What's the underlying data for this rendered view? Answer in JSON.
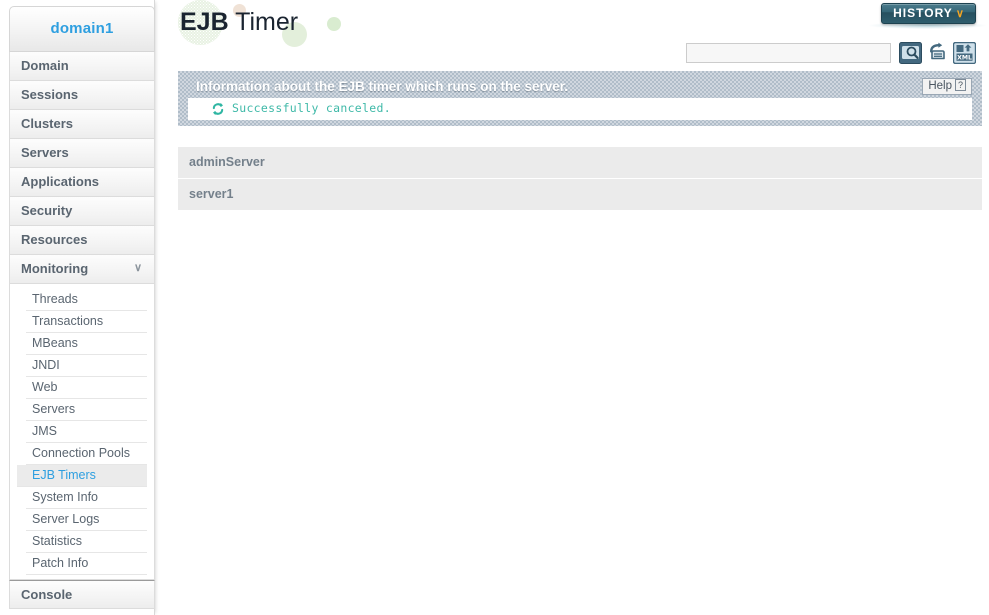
{
  "sidebar": {
    "domain_label": "domain1",
    "items": [
      {
        "label": "Domain",
        "expandable": false
      },
      {
        "label": "Sessions",
        "expandable": false
      },
      {
        "label": "Clusters",
        "expandable": false
      },
      {
        "label": "Servers",
        "expandable": false
      },
      {
        "label": "Applications",
        "expandable": false
      },
      {
        "label": "Security",
        "expandable": false
      },
      {
        "label": "Resources",
        "expandable": false
      },
      {
        "label": "Monitoring",
        "expandable": true,
        "chevron": "∨"
      }
    ],
    "monitoring_submenu": [
      {
        "label": "Threads",
        "selected": false
      },
      {
        "label": "Transactions",
        "selected": false
      },
      {
        "label": "MBeans",
        "selected": false
      },
      {
        "label": "JNDI",
        "selected": false
      },
      {
        "label": "Web",
        "selected": false
      },
      {
        "label": "Servers",
        "selected": false
      },
      {
        "label": "JMS",
        "selected": false
      },
      {
        "label": "Connection Pools",
        "selected": false
      },
      {
        "label": "EJB Timers",
        "selected": true
      },
      {
        "label": "System Info",
        "selected": false
      },
      {
        "label": "Server Logs",
        "selected": false
      },
      {
        "label": "Statistics",
        "selected": false
      },
      {
        "label": "Patch Info",
        "selected": false
      }
    ],
    "console_label": "Console",
    "selected_color": "#2e9fe0"
  },
  "header": {
    "title_strong": "EJB",
    "title_light": " Timer",
    "history_label": "HISTORY",
    "history_chevron": "∨",
    "history_chevron_color": "#f5a623"
  },
  "search": {
    "value": "",
    "placeholder": "",
    "buttons": [
      {
        "icon": "search-icon",
        "title": "Search"
      },
      {
        "icon": "refresh-icon",
        "title": "Refresh"
      },
      {
        "icon": "xml-export-icon",
        "title": "XML"
      }
    ]
  },
  "info_panel": {
    "title": "Information about the EJB timer which runs on the server.",
    "help_label": "Help",
    "help_mark": "?",
    "message": "Successfully canceled.",
    "message_icon": "sync-icon",
    "message_color": "#3fb9a8"
  },
  "server_list": {
    "rows": [
      {
        "name": "adminServer"
      },
      {
        "name": "server1"
      }
    ]
  }
}
